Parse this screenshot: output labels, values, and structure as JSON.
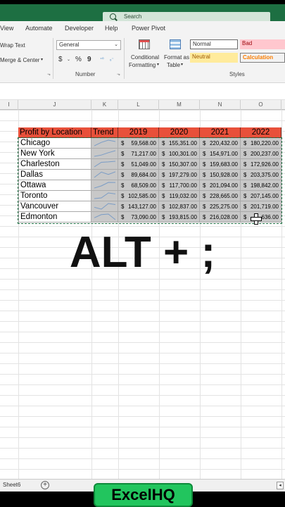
{
  "colors": {
    "excel_green": "#1d6f42",
    "header_red": "#e8503a",
    "table_gray": "#c8c8c8",
    "brand_green": "#22c55e"
  },
  "search": {
    "label": "Search",
    "icon": "search-icon"
  },
  "menu": {
    "items": [
      "View",
      "Automate",
      "Developer",
      "Help",
      "Power Pivot"
    ]
  },
  "ribbon": {
    "wrap_text": "Wrap Text",
    "merge_center": "Merge & Center",
    "number_format": "General",
    "number_group_label": "Number",
    "currency_symbol": "$",
    "percent_symbol": "%",
    "comma_symbol": "9",
    "conditional_formatting": [
      "Conditional",
      "Formatting"
    ],
    "format_as_table": [
      "Format as",
      "Table"
    ],
    "styles": {
      "normal": "Normal",
      "bad": "Bad",
      "neutral": "Neutral",
      "calculation": "Calculation"
    },
    "styles_group_label": "Styles"
  },
  "columns": [
    "I",
    "J",
    "K",
    "L",
    "M",
    "N",
    "O"
  ],
  "table": {
    "headers": [
      "Profit by Location",
      "Trend",
      "2019",
      "2020",
      "2021",
      "2022"
    ],
    "rows": [
      {
        "city": "Chicago",
        "v": [
          "59,568.00",
          "155,351.00",
          "220,432.00",
          "180,220.00"
        ]
      },
      {
        "city": "New York",
        "v": [
          "71,217.00",
          "100,301.00",
          "154,971.00",
          "200,237.00"
        ]
      },
      {
        "city": "Charleston",
        "v": [
          "51,049.00",
          "150,307.00",
          "159,683.00",
          "172,926.00"
        ]
      },
      {
        "city": "Dallas",
        "v": [
          "89,684.00",
          "197,279.00",
          "150,928.00",
          "203,375.00"
        ]
      },
      {
        "city": "Ottawa",
        "v": [
          "68,509.00",
          "117,700.00",
          "201,094.00",
          "198,842.00"
        ]
      },
      {
        "city": "Toronto",
        "v": [
          "102,585.00",
          "119,032.00",
          "228,665.00",
          "207,145.00"
        ]
      },
      {
        "city": "Vancouver",
        "v": [
          "143,127.00",
          "102,837.00",
          "225,275.00",
          "201,719.00"
        ]
      },
      {
        "city": "Edmonton",
        "v": [
          "73,090.00",
          "193,815.00",
          "216,028.00",
          "636.00"
        ]
      }
    ],
    "currency": "$"
  },
  "overlay_text": "ALT + ;",
  "sheet_tab": "Sheet6",
  "brand": "ExcelHQ"
}
